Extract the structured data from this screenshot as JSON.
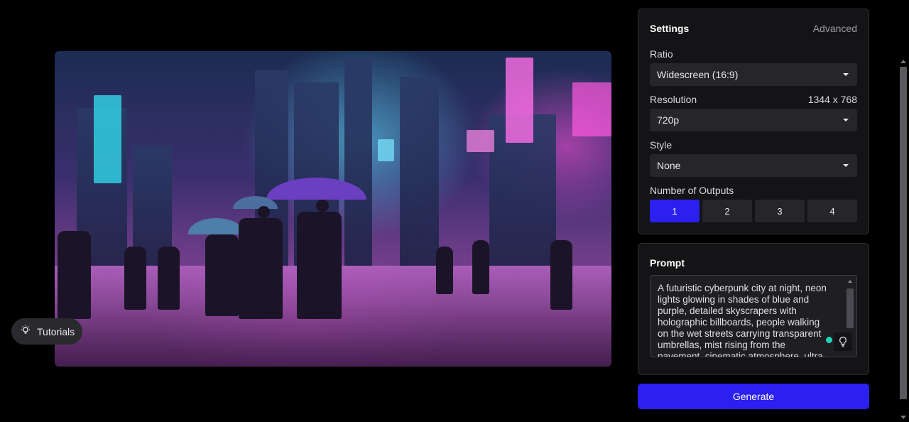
{
  "tutorials": {
    "label": "Tutorials"
  },
  "settings": {
    "title": "Settings",
    "advanced_label": "Advanced",
    "ratio": {
      "label": "Ratio",
      "value": "Widescreen (16:9)"
    },
    "resolution": {
      "label": "Resolution",
      "dimensions": "1344 x 768",
      "value": "720p"
    },
    "style": {
      "label": "Style",
      "value": "None"
    },
    "outputs": {
      "label": "Number of Outputs",
      "options": [
        "1",
        "2",
        "3",
        "4"
      ],
      "selected": "1"
    }
  },
  "prompt": {
    "title": "Prompt",
    "value": "A futuristic cyberpunk city at night, neon lights glowing in shades of blue and purple, detailed skyscrapers with holographic billboards, people walking on the wet streets carrying transparent umbrellas, mist rising from the pavement, cinematic atmosphere, ultra-detailed"
  },
  "generate": {
    "label": "Generate"
  },
  "colors": {
    "accent": "#2b20f0",
    "panel_bg": "#141416",
    "page_bg": "#000000"
  },
  "icons": {
    "tutorials": "lightbulb-icon",
    "prompt_helper": "lightbulb-icon",
    "select_caret": "caret-down-icon"
  }
}
